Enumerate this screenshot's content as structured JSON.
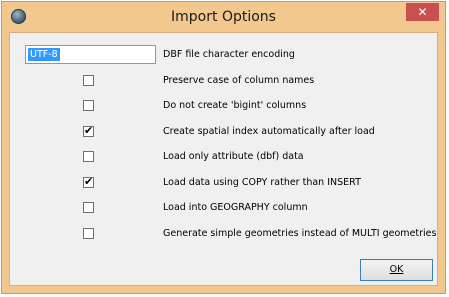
{
  "window": {
    "title": "Import Options",
    "close_label": "✕"
  },
  "encoding": {
    "value": "UTF-8",
    "label": "DBF file character encoding"
  },
  "options": [
    {
      "label": "Preserve case of column names",
      "checked": false
    },
    {
      "label": "Do not create 'bigint' columns",
      "checked": false
    },
    {
      "label": "Create spatial index automatically after load",
      "checked": true
    },
    {
      "label": "Load only attribute (dbf) data",
      "checked": false
    },
    {
      "label": "Load data using COPY rather than INSERT",
      "checked": true
    },
    {
      "label": "Load into GEOGRAPHY column",
      "checked": false
    },
    {
      "label": "Generate simple geometries instead of MULTI geometries",
      "checked": false
    }
  ],
  "buttons": {
    "ok_label": "OK"
  },
  "colors": {
    "frame": "#f3c88e",
    "client": "#f0f0f0",
    "close": "#c75050",
    "selection": "#3399ff"
  }
}
